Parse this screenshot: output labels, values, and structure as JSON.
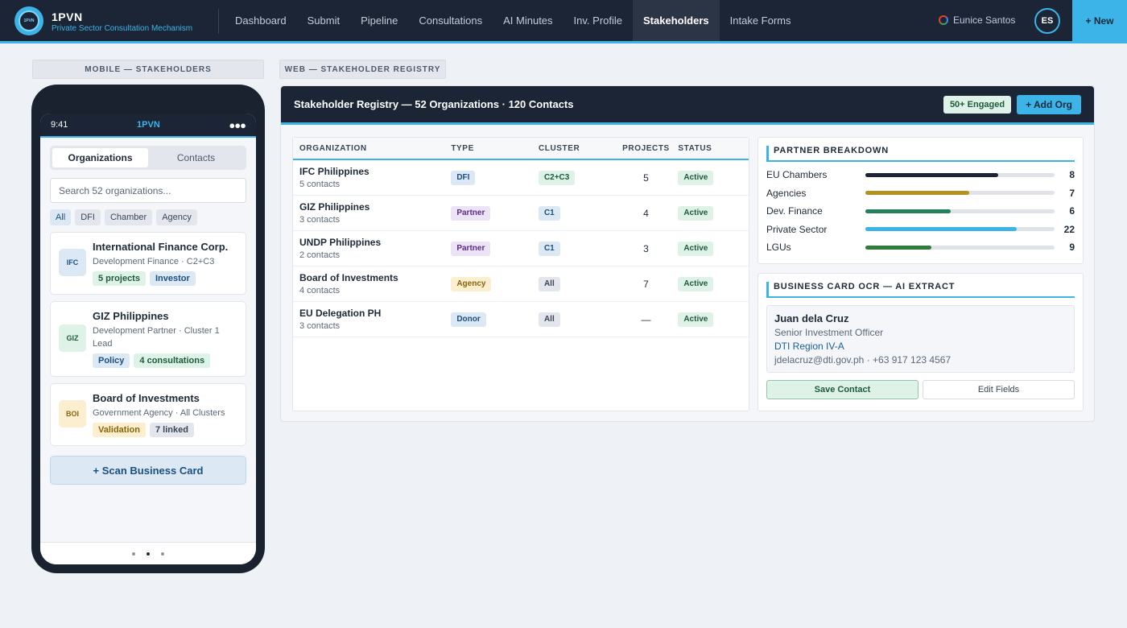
{
  "app": {
    "logo_text": "1PVN",
    "name": "1PVN",
    "subtitle": "Private Sector Consultation Mechanism"
  },
  "nav": [
    "Dashboard",
    "Submit",
    "Pipeline",
    "Consultations",
    "AI Minutes",
    "Inv. Profile",
    "Stakeholders",
    "Intake Forms"
  ],
  "nav_active": "Stakeholders",
  "user": {
    "name": "Eunice Santos",
    "initials": "ES"
  },
  "new_button": "+ New",
  "mobile": {
    "section_label": "MOBILE — STAKEHOLDERS",
    "time": "9:41",
    "app": "1PVN",
    "signal": "●●●",
    "tabs": [
      "Organizations",
      "Contacts"
    ],
    "search_placeholder": "Search 52 organizations...",
    "filters": [
      "All",
      "DFI",
      "Chamber",
      "Agency"
    ],
    "cards": [
      {
        "badge": "IFC",
        "title": "International Finance Corp.",
        "sub": "Development Finance · C2+C3",
        "tags": [
          "5 projects",
          "Investor"
        ]
      },
      {
        "badge": "GIZ",
        "title": "GIZ Philippines",
        "sub": "Development Partner · Cluster 1 Lead",
        "tags": [
          "Policy",
          "4 consultations"
        ]
      },
      {
        "badge": "BOI",
        "title": "Board of Investments",
        "sub": "Government Agency · All Clusters",
        "tags": [
          "Validation",
          "7 linked"
        ]
      }
    ],
    "scan_button": "+ Scan Business Card"
  },
  "web": {
    "section_label": "WEB — STAKEHOLDER REGISTRY",
    "title": "Stakeholder Registry — 52 Organizations · 120 Contacts",
    "engaged_badge": "50+ Engaged",
    "add_button": "+ Add Org",
    "columns": [
      "ORGANIZATION",
      "TYPE",
      "CLUSTER",
      "PROJECTS",
      "STATUS"
    ],
    "rows": [
      {
        "name": "IFC Philippines",
        "contacts": "5 contacts",
        "type": "DFI",
        "cluster": "C2+C3",
        "projects": "5",
        "status": "Active"
      },
      {
        "name": "GIZ Philippines",
        "contacts": "3 contacts",
        "type": "Partner",
        "cluster": "C1",
        "projects": "4",
        "status": "Active"
      },
      {
        "name": "UNDP Philippines",
        "contacts": "2 contacts",
        "type": "Partner",
        "cluster": "C1",
        "projects": "3",
        "status": "Active"
      },
      {
        "name": "Board of Investments",
        "contacts": "4 contacts",
        "type": "Agency",
        "cluster": "All",
        "projects": "7",
        "status": "Active"
      },
      {
        "name": "EU Delegation PH",
        "contacts": "3 contacts",
        "type": "Donor",
        "cluster": "All",
        "projects": "—",
        "status": "Active"
      }
    ],
    "breakdown": {
      "title": "PARTNER BREAKDOWN",
      "items": [
        {
          "label": "EU Chambers",
          "value": "8",
          "fill": 0.7,
          "color": "#1c2535"
        },
        {
          "label": "Agencies",
          "value": "7",
          "fill": 0.55,
          "color": "#b8901f"
        },
        {
          "label": "Dev. Finance",
          "value": "6",
          "fill": 0.45,
          "color": "#24805a"
        },
        {
          "label": "Private Sector",
          "value": "22",
          "fill": 0.8,
          "color": "#3cb4e8"
        },
        {
          "label": "LGUs",
          "value": "9",
          "fill": 0.35,
          "color": "#2e7d3a"
        }
      ]
    },
    "ocr": {
      "title": "BUSINESS CARD OCR — AI EXTRACT",
      "name": "Juan dela Cruz",
      "role": "Senior Investment Officer",
      "org": "DTI Region IV-A",
      "contact": "jdelacruz@dti.gov.ph · +63 917 123 4567",
      "save": "Save Contact",
      "edit": "Edit Fields"
    }
  }
}
